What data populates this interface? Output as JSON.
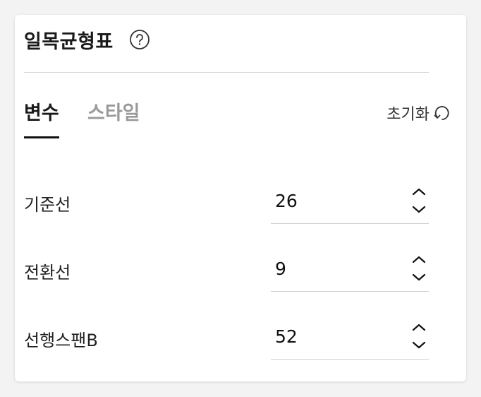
{
  "panel": {
    "title": "일목균형표",
    "help_icon": "help-circle-icon"
  },
  "tabs": [
    {
      "label": "변수",
      "active": true
    },
    {
      "label": "스타일",
      "active": false
    }
  ],
  "reset": {
    "label": "초기화",
    "icon": "reset-icon"
  },
  "fields": [
    {
      "label": "기준선",
      "value": "26"
    },
    {
      "label": "전환선",
      "value": "9"
    },
    {
      "label": "선행스팬B",
      "value": "52"
    }
  ],
  "colors": {
    "text": "#1a1a1a",
    "inactive_tab": "#9a9a9a",
    "divider": "#d8d8d8"
  }
}
